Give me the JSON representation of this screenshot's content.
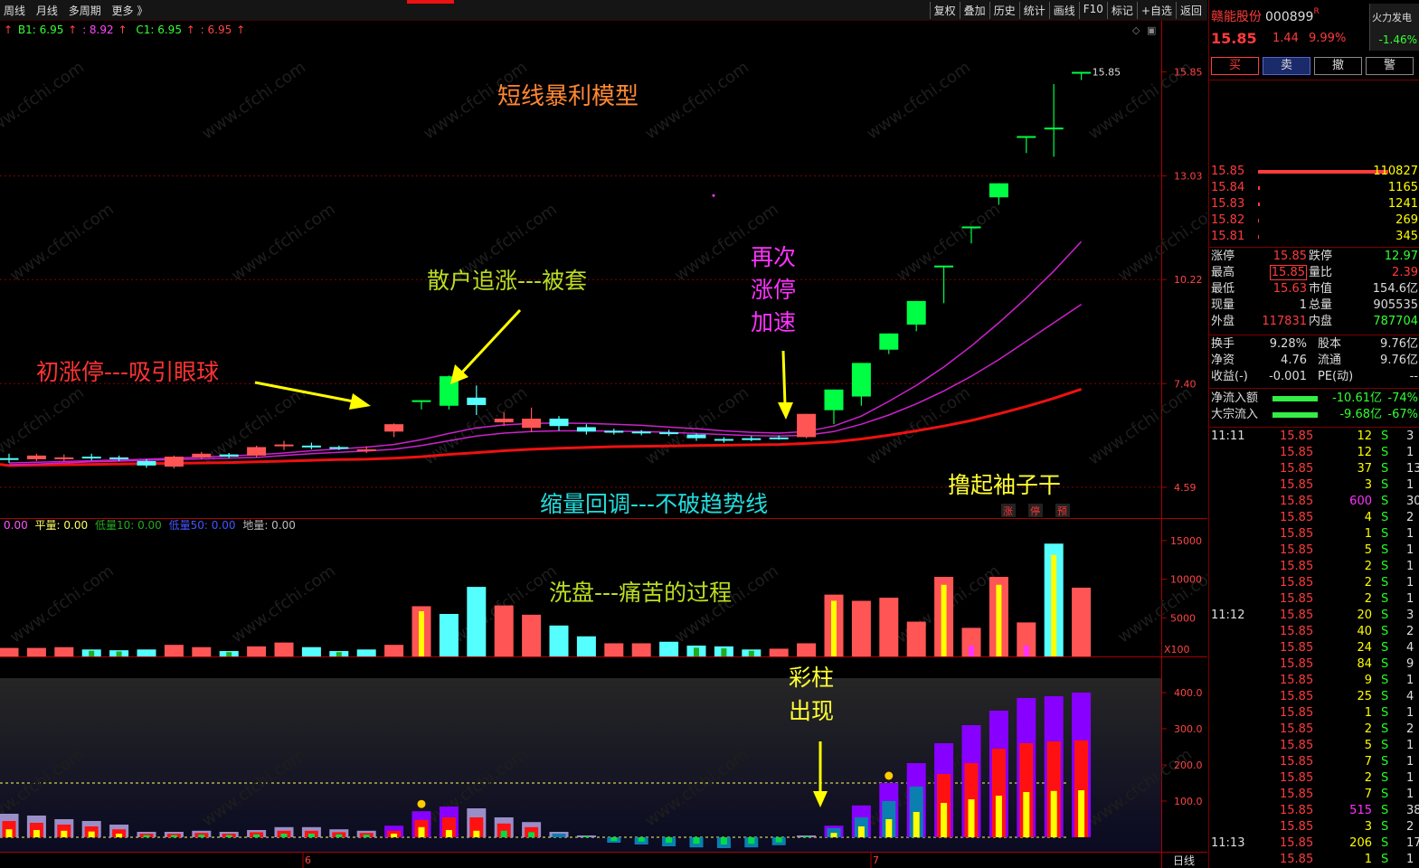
{
  "toolbar": {
    "left": [
      "周线",
      "月线",
      "多周期",
      "更多 》"
    ],
    "right": [
      "复权",
      "叠加",
      "历史",
      "统计",
      "画线",
      "F10",
      "标记",
      "+自选",
      "返回"
    ]
  },
  "indicator_line": {
    "b1": "B1: 6.95",
    "b1_arrow": "↑",
    "p2": ": 8.92",
    "p2_arrow": "↑",
    "c1": "C1: 6.95",
    "c1_arrow": "↑",
    "p4": ": 6.95",
    "p4_arrow": "↑"
  },
  "volume_legend": {
    "a": "0.00",
    "b": "平量: 0.00",
    "c": "低量10: 0.00",
    "d": "低量50: 0.00",
    "e": "地量: 0.00"
  },
  "annotations": {
    "title": "短线暴利模型",
    "first_limit": "初涨停---吸引眼球",
    "retail": "散户追涨---被套",
    "again1": "再次",
    "again2": "涨停",
    "again3": "加速",
    "shrink": "缩量回调---不破趋势线",
    "wash": "洗盘---痛苦的过程",
    "roll": "撸起袖子干",
    "roll_tag1": "涨",
    "roll_tag2": "停",
    "roll_tag3": "预",
    "color1": "彩柱",
    "color2": "出现"
  },
  "watermark": "www.cfchi.com",
  "chart_data": [
    {
      "type": "candlestick",
      "axis_labels": [
        "15.85",
        "13.03",
        "10.22",
        "7.40",
        "4.59"
      ],
      "axis_values": [
        15.85,
        13.03,
        10.22,
        7.4,
        4.59
      ],
      "ylim": [
        4.0,
        16.5
      ],
      "last_label": "15.85",
      "up_color": "#ff5555",
      "down_color": "#55ffff",
      "limit_color": "#00ff44",
      "candles": [
        {
          "o": 5.35,
          "c": 5.38,
          "h": 5.5,
          "l": 5.25,
          "t": "d"
        },
        {
          "o": 5.35,
          "c": 5.45,
          "h": 5.5,
          "l": 5.3,
          "t": "u"
        },
        {
          "o": 5.38,
          "c": 5.4,
          "h": 5.48,
          "l": 5.3,
          "t": "u"
        },
        {
          "o": 5.42,
          "c": 5.38,
          "h": 5.5,
          "l": 5.32,
          "t": "d"
        },
        {
          "o": 5.4,
          "c": 5.36,
          "h": 5.45,
          "l": 5.3,
          "t": "d"
        },
        {
          "o": 5.3,
          "c": 5.18,
          "h": 5.35,
          "l": 5.12,
          "t": "d"
        },
        {
          "o": 5.15,
          "c": 5.42,
          "h": 5.45,
          "l": 5.1,
          "t": "u"
        },
        {
          "o": 5.4,
          "c": 5.5,
          "h": 5.55,
          "l": 5.35,
          "t": "u"
        },
        {
          "o": 5.48,
          "c": 5.42,
          "h": 5.52,
          "l": 5.38,
          "t": "d"
        },
        {
          "o": 5.45,
          "c": 5.68,
          "h": 5.72,
          "l": 5.4,
          "t": "u"
        },
        {
          "o": 5.72,
          "c": 5.75,
          "h": 5.85,
          "l": 5.6,
          "t": "u"
        },
        {
          "o": 5.72,
          "c": 5.7,
          "h": 5.8,
          "l": 5.62,
          "t": "d"
        },
        {
          "o": 5.68,
          "c": 5.65,
          "h": 5.72,
          "l": 5.6,
          "t": "d"
        },
        {
          "o": 5.58,
          "c": 5.62,
          "h": 5.7,
          "l": 5.52,
          "t": "u"
        },
        {
          "o": 6.1,
          "c": 6.3,
          "h": 6.32,
          "l": 5.95,
          "t": "u"
        },
        {
          "o": 6.93,
          "c": 6.95,
          "h": 6.95,
          "l": 6.7,
          "t": "l"
        },
        {
          "o": 6.8,
          "c": 7.6,
          "h": 7.62,
          "l": 6.7,
          "t": "l"
        },
        {
          "o": 7.02,
          "c": 6.82,
          "h": 7.35,
          "l": 6.55,
          "t": "d"
        },
        {
          "o": 6.35,
          "c": 6.45,
          "h": 6.62,
          "l": 6.25,
          "t": "u"
        },
        {
          "o": 6.2,
          "c": 6.45,
          "h": 6.75,
          "l": 6.08,
          "t": "u"
        },
        {
          "o": 6.45,
          "c": 6.25,
          "h": 6.52,
          "l": 6.12,
          "t": "d"
        },
        {
          "o": 6.22,
          "c": 6.1,
          "h": 6.3,
          "l": 6.02,
          "t": "d"
        },
        {
          "o": 6.12,
          "c": 6.08,
          "h": 6.18,
          "l": 6.02,
          "t": "d"
        },
        {
          "o": 6.1,
          "c": 6.06,
          "h": 6.14,
          "l": 6.0,
          "t": "d"
        },
        {
          "o": 6.08,
          "c": 6.04,
          "h": 6.15,
          "l": 5.98,
          "t": "d"
        },
        {
          "o": 6.02,
          "c": 5.92,
          "h": 6.05,
          "l": 5.85,
          "t": "d"
        },
        {
          "o": 5.9,
          "c": 5.86,
          "h": 5.95,
          "l": 5.8,
          "t": "d"
        },
        {
          "o": 5.88,
          "c": 5.92,
          "h": 5.98,
          "l": 5.84,
          "t": "d"
        },
        {
          "o": 5.92,
          "c": 5.94,
          "h": 6.0,
          "l": 5.88,
          "t": "d"
        },
        {
          "o": 5.95,
          "c": 6.58,
          "h": 6.58,
          "l": 5.92,
          "t": "u"
        },
        {
          "o": 6.68,
          "c": 7.24,
          "h": 7.24,
          "l": 6.3,
          "t": "l"
        },
        {
          "o": 7.05,
          "c": 7.96,
          "h": 7.96,
          "l": 6.8,
          "t": "l"
        },
        {
          "o": 8.32,
          "c": 8.76,
          "h": 8.76,
          "l": 8.2,
          "t": "l"
        },
        {
          "o": 9.0,
          "c": 9.64,
          "h": 9.64,
          "l": 8.82,
          "t": "l"
        },
        {
          "o": 10.6,
          "c": 10.6,
          "h": 10.6,
          "l": 9.58,
          "t": "l"
        },
        {
          "o": 11.66,
          "c": 11.66,
          "h": 11.66,
          "l": 11.2,
          "t": "l"
        },
        {
          "o": 12.45,
          "c": 12.83,
          "h": 12.83,
          "l": 12.25,
          "t": "l"
        },
        {
          "o": 14.11,
          "c": 14.11,
          "h": 14.11,
          "l": 13.65,
          "t": "l"
        },
        {
          "o": 14.34,
          "c": 14.34,
          "h": 15.52,
          "l": 13.55,
          "t": "l"
        },
        {
          "o": 15.85,
          "c": 15.85,
          "h": 15.85,
          "l": 15.63,
          "t": "l"
        }
      ],
      "ma_red": [
        5.18,
        5.19,
        5.2,
        5.21,
        5.22,
        5.23,
        5.24,
        5.25,
        5.26,
        5.28,
        5.3,
        5.32,
        5.34,
        5.35,
        5.38,
        5.42,
        5.48,
        5.53,
        5.58,
        5.62,
        5.65,
        5.67,
        5.69,
        5.7,
        5.71,
        5.72,
        5.73,
        5.74,
        5.75,
        5.78,
        5.82,
        5.9,
        6.0,
        6.12,
        6.25,
        6.4,
        6.58,
        6.78,
        7.0,
        7.25
      ],
      "ma_p1": [
        5.2,
        5.22,
        5.25,
        5.28,
        5.3,
        5.32,
        5.34,
        5.36,
        5.38,
        5.4,
        5.45,
        5.5,
        5.54,
        5.57,
        5.62,
        5.72,
        5.85,
        5.98,
        6.06,
        6.1,
        6.12,
        6.12,
        6.11,
        6.1,
        6.08,
        6.05,
        6.02,
        5.99,
        5.98,
        6.0,
        6.1,
        6.3,
        6.55,
        6.85,
        7.2,
        7.6,
        8.05,
        8.55,
        9.05,
        9.55
      ],
      "ma_p2": [
        5.25,
        5.27,
        5.29,
        5.31,
        5.33,
        5.35,
        5.38,
        5.41,
        5.44,
        5.47,
        5.52,
        5.58,
        5.63,
        5.68,
        5.75,
        5.88,
        6.05,
        6.2,
        6.28,
        6.32,
        6.33,
        6.32,
        6.3,
        6.27,
        6.22,
        6.18,
        6.12,
        6.08,
        6.06,
        6.1,
        6.25,
        6.52,
        6.92,
        7.35,
        7.85,
        8.42,
        9.05,
        9.72,
        10.45,
        11.25
      ]
    },
    {
      "type": "bar",
      "axis_labels": [
        "15000",
        "10000",
        "5000"
      ],
      "axis_values": [
        15000,
        10000,
        5000
      ],
      "ylim": [
        0,
        15800
      ],
      "unit": "X100",
      "bars": [
        {
          "v": 1100,
          "c": "up"
        },
        {
          "v": 1100,
          "c": "up"
        },
        {
          "v": 1200,
          "c": "up"
        },
        {
          "v": 900,
          "c": "dn",
          "i": "g"
        },
        {
          "v": 800,
          "c": "dn",
          "i": "g"
        },
        {
          "v": 900,
          "c": "dn"
        },
        {
          "v": 1500,
          "c": "up"
        },
        {
          "v": 1200,
          "c": "up"
        },
        {
          "v": 700,
          "c": "dn",
          "i": "g"
        },
        {
          "v": 1300,
          "c": "up"
        },
        {
          "v": 1800,
          "c": "up"
        },
        {
          "v": 1200,
          "c": "dn"
        },
        {
          "v": 700,
          "c": "dn",
          "i": "g"
        },
        {
          "v": 900,
          "c": "dn"
        },
        {
          "v": 1500,
          "c": "up"
        },
        {
          "v": 6500,
          "c": "up",
          "i": "y"
        },
        {
          "v": 5500,
          "c": "dn"
        },
        {
          "v": 9000,
          "c": "dn"
        },
        {
          "v": 6600,
          "c": "up"
        },
        {
          "v": 5400,
          "c": "up"
        },
        {
          "v": 4000,
          "c": "dn"
        },
        {
          "v": 2600,
          "c": "dn"
        },
        {
          "v": 1700,
          "c": "up"
        },
        {
          "v": 1700,
          "c": "up"
        },
        {
          "v": 1900,
          "c": "dn"
        },
        {
          "v": 1400,
          "c": "dn",
          "i": "g"
        },
        {
          "v": 1300,
          "c": "dn",
          "i": "g"
        },
        {
          "v": 900,
          "c": "dn",
          "i": "g"
        },
        {
          "v": 1000,
          "c": "up"
        },
        {
          "v": 1700,
          "c": "up"
        },
        {
          "v": 8000,
          "c": "up",
          "i": "y"
        },
        {
          "v": 7200,
          "c": "up"
        },
        {
          "v": 7600,
          "c": "up"
        },
        {
          "v": 4500,
          "c": "up"
        },
        {
          "v": 10300,
          "c": "up",
          "i": "y"
        },
        {
          "v": 3700,
          "c": "up",
          "i": "m"
        },
        {
          "v": 10300,
          "c": "up",
          "i": "y"
        },
        {
          "v": 4400,
          "c": "up",
          "i": "m"
        },
        {
          "v": 14600,
          "c": "dn",
          "i": "y"
        },
        {
          "v": 8900,
          "c": "up"
        }
      ]
    },
    {
      "type": "bar",
      "axis_labels": [
        "400.0",
        "300.0",
        "200.0",
        "100.0"
      ],
      "axis_values": [
        400,
        300,
        200,
        100
      ],
      "ylim": [
        -35,
        415
      ],
      "dashed_level": 150,
      "bars": [
        {
          "o": 65,
          "r": 45,
          "y": 22
        },
        {
          "o": 60,
          "r": 40,
          "y": 20
        },
        {
          "o": 50,
          "r": 35,
          "y": 18
        },
        {
          "o": 45,
          "r": 30,
          "y": 16
        },
        {
          "o": 35,
          "r": 22,
          "y": 10
        },
        {
          "o": 15,
          "r": 10,
          "g": 6
        },
        {
          "o": 15,
          "r": 10,
          "g": 6
        },
        {
          "o": 18,
          "r": 12,
          "g": 7
        },
        {
          "o": 15,
          "r": 10,
          "g": 6
        },
        {
          "o": 20,
          "r": 14,
          "g": 8
        },
        {
          "o": 28,
          "r": 18,
          "g": 10
        },
        {
          "o": 28,
          "r": 18,
          "g": 10
        },
        {
          "o": 22,
          "r": 14,
          "g": 8
        },
        {
          "o": 18,
          "r": 12,
          "g": 7
        },
        {
          "o": 32,
          "p": 32,
          "r": 18,
          "y": 10
        },
        {
          "o": 72,
          "p": 72,
          "r": 48,
          "y": 28,
          "dot": true
        },
        {
          "o": 85,
          "p": 85,
          "r": 55,
          "y": 20
        },
        {
          "o": 80,
          "r": 55,
          "y": 18
        },
        {
          "o": 55,
          "r": 38,
          "g": 18
        },
        {
          "o": 42,
          "r": 28,
          "g": 14
        },
        {
          "o": 15,
          "b": 10
        },
        {
          "o": 5,
          "g": 3
        },
        {
          "b": -15,
          "g": -10
        },
        {
          "b": -20,
          "g": -12
        },
        {
          "b": -25,
          "g": -15
        },
        {
          "b": -28,
          "g": -18
        },
        {
          "b": -30,
          "g": -20
        },
        {
          "b": -28,
          "g": -18
        },
        {
          "b": -22,
          "g": -14
        },
        {
          "o": 5,
          "g": 3
        },
        {
          "o": 32,
          "p": 32,
          "b": 25,
          "y": 12
        },
        {
          "o": 88,
          "p": 88,
          "b": 55,
          "y": 30
        },
        {
          "o": 150,
          "p": 150,
          "b": 100,
          "y": 50,
          "dot": true
        },
        {
          "o": 205,
          "p": 205,
          "b": 140,
          "y": 70
        },
        {
          "o": 260,
          "p": 260,
          "r": 175,
          "y": 95
        },
        {
          "o": 310,
          "p": 310,
          "r": 205,
          "y": 105
        },
        {
          "o": 350,
          "p": 350,
          "r": 245,
          "y": 115
        },
        {
          "o": 385,
          "p": 385,
          "r": 260,
          "y": 125
        },
        {
          "o": 390,
          "p": 390,
          "r": 265,
          "y": 128
        },
        {
          "o": 400,
          "p": 400,
          "r": 268,
          "y": 130
        }
      ]
    }
  ],
  "xaxis": {
    "m6": "6",
    "m7": "7",
    "period": "日线"
  },
  "stock": {
    "name": "赣能股份",
    "code": "000899",
    "r": "R",
    "price": "15.85",
    "change": "1.44",
    "pct": "9.99%",
    "hot": "火力发电",
    "hot_chg": "-1.46%"
  },
  "actions": {
    "buy": "买",
    "sell": "卖",
    "cancel": "撤",
    "alert": "警"
  },
  "orderbook": [
    {
      "p": "15.85",
      "v": "110827",
      "w": 160
    },
    {
      "p": "15.84",
      "v": "1165",
      "w": 2
    },
    {
      "p": "15.83",
      "v": "1241",
      "w": 2
    },
    {
      "p": "15.82",
      "v": "269",
      "w": 1
    },
    {
      "p": "15.81",
      "v": "345",
      "w": 1
    }
  ],
  "quote": [
    {
      "l1": "涨停",
      "v1": "15.85",
      "c1": "red",
      "l2": "跌停",
      "v2": "12.97",
      "c2": "green"
    },
    {
      "l1": "最高",
      "v1": "15.85",
      "c1": "red",
      "box": true,
      "l2": "量比",
      "v2": "2.39",
      "c2": "red"
    },
    {
      "l1": "最低",
      "v1": "15.63",
      "c1": "red",
      "l2": "市值",
      "v2": "154.6亿",
      "c2": "white"
    },
    {
      "l1": "现量",
      "v1": "1",
      "c1": "white",
      "l2": "总量",
      "v2": "905535",
      "c2": "white"
    },
    {
      "l1": "外盘",
      "v1": "117831",
      "c1": "red",
      "l2": "内盘",
      "v2": "787704",
      "c2": "green"
    }
  ],
  "quote2": [
    {
      "l1": "换手",
      "v1": "9.28%",
      "l2": "股本",
      "v2": "9.76亿"
    },
    {
      "l1": "净资",
      "v1": "4.76",
      "l2": "流通",
      "v2": "9.76亿"
    },
    {
      "l1": "收益(-)",
      "v1": "-0.001",
      "l2": "PE(动)",
      "v2": "--"
    }
  ],
  "flows": [
    {
      "l": "净流入额",
      "v": "-10.61亿",
      "p": "-74%"
    },
    {
      "l": "大宗流入",
      "v": "-9.68亿",
      "p": "-67%"
    }
  ],
  "ticks": [
    {
      "t": "11:11",
      "p": "15.85",
      "v": "12",
      "s": "S",
      "n": "3"
    },
    {
      "t": "",
      "p": "15.85",
      "v": "12",
      "s": "S",
      "n": "1"
    },
    {
      "t": "",
      "p": "15.85",
      "v": "37",
      "s": "S",
      "n": "13"
    },
    {
      "t": "",
      "p": "15.85",
      "v": "3",
      "s": "S",
      "n": "1"
    },
    {
      "t": "",
      "p": "15.85",
      "v": "600",
      "s": "S",
      "n": "30",
      "vc": "mag"
    },
    {
      "t": "",
      "p": "15.85",
      "v": "4",
      "s": "S",
      "n": "2"
    },
    {
      "t": "",
      "p": "15.85",
      "v": "1",
      "s": "S",
      "n": "1"
    },
    {
      "t": "",
      "p": "15.85",
      "v": "5",
      "s": "S",
      "n": "1"
    },
    {
      "t": "",
      "p": "15.85",
      "v": "2",
      "s": "S",
      "n": "1"
    },
    {
      "t": "",
      "p": "15.85",
      "v": "2",
      "s": "S",
      "n": "1"
    },
    {
      "t": "",
      "p": "15.85",
      "v": "2",
      "s": "S",
      "n": "1"
    },
    {
      "t": "11:12",
      "p": "15.85",
      "v": "20",
      "s": "S",
      "n": "3"
    },
    {
      "t": "",
      "p": "15.85",
      "v": "40",
      "s": "S",
      "n": "2"
    },
    {
      "t": "",
      "p": "15.85",
      "v": "24",
      "s": "S",
      "n": "4"
    },
    {
      "t": "",
      "p": "15.85",
      "v": "84",
      "s": "S",
      "n": "9"
    },
    {
      "t": "",
      "p": "15.85",
      "v": "9",
      "s": "S",
      "n": "1"
    },
    {
      "t": "",
      "p": "15.85",
      "v": "25",
      "s": "S",
      "n": "4"
    },
    {
      "t": "",
      "p": "15.85",
      "v": "1",
      "s": "S",
      "n": "1"
    },
    {
      "t": "",
      "p": "15.85",
      "v": "2",
      "s": "S",
      "n": "2"
    },
    {
      "t": "",
      "p": "15.85",
      "v": "5",
      "s": "S",
      "n": "1"
    },
    {
      "t": "",
      "p": "15.85",
      "v": "7",
      "s": "S",
      "n": "1"
    },
    {
      "t": "",
      "p": "15.85",
      "v": "2",
      "s": "S",
      "n": "1"
    },
    {
      "t": "",
      "p": "15.85",
      "v": "7",
      "s": "S",
      "n": "1"
    },
    {
      "t": "",
      "p": "15.85",
      "v": "515",
      "s": "S",
      "n": "38",
      "vc": "mag"
    },
    {
      "t": "",
      "p": "15.85",
      "v": "3",
      "s": "S",
      "n": "2"
    },
    {
      "t": "11:13",
      "p": "15.85",
      "v": "206",
      "s": "S",
      "n": "17"
    },
    {
      "t": "",
      "p": "15.85",
      "v": "1",
      "s": "S",
      "n": "1"
    }
  ]
}
